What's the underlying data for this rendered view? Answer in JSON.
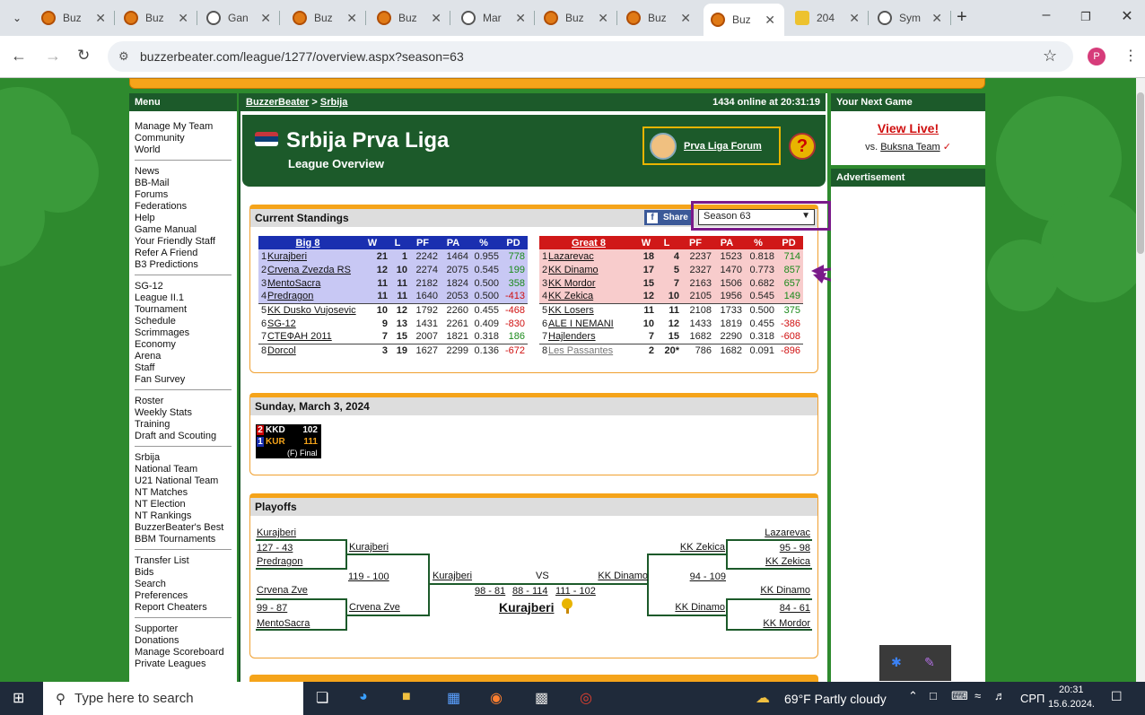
{
  "browser": {
    "tabs": [
      {
        "label": "Buz",
        "icon": "basketball-icon"
      },
      {
        "label": "Buz",
        "icon": "basketball-icon"
      },
      {
        "label": "Gan",
        "icon": "clock-icon"
      },
      {
        "label": "Buz",
        "icon": "basketball-icon"
      },
      {
        "label": "Buz",
        "icon": "basketball-icon"
      },
      {
        "label": "Mar",
        "icon": "chain-icon"
      },
      {
        "label": "Buz",
        "icon": "basketball-icon"
      },
      {
        "label": "Buz",
        "icon": "basketball-icon"
      },
      {
        "label": "Buz",
        "icon": "basketball-icon"
      },
      {
        "label": "204",
        "icon": "2048-icon"
      },
      {
        "label": "Sym",
        "icon": "symbol-icon"
      }
    ],
    "url": "buzzerbeater.com/league/1277/overview.aspx?season=63",
    "profile_initial": "P"
  },
  "left_menu": {
    "title": "Menu",
    "groups": [
      [
        "Manage My Team",
        "Community",
        "World"
      ],
      [
        "News",
        "BB-Mail",
        "Forums",
        "Federations",
        "Help",
        "Game Manual",
        "Your Friendly Staff",
        "Refer A Friend",
        "B3 Predictions"
      ],
      [
        "SG-12",
        "League II.1",
        "Tournament",
        "Schedule",
        "Scrimmages",
        "Economy",
        "Arena",
        "Staff",
        "Fan Survey"
      ],
      [
        "Roster",
        "Weekly Stats",
        "Training",
        "Draft and Scouting"
      ],
      [
        "Srbija",
        "National Team",
        "U21 National Team",
        "NT Matches",
        "NT Election",
        "NT Rankings",
        "BuzzerBeater's Best",
        "BBM Tournaments"
      ],
      [
        "Transfer List",
        "Bids",
        "Search",
        "Preferences",
        "Report Cheaters"
      ],
      [
        "Supporter",
        "Donations",
        "Manage Scoreboard",
        "Private Leagues"
      ]
    ]
  },
  "breadcrumb": {
    "root": "BuzzerBeater",
    "sep": " > ",
    "current": "Srbija",
    "online": "1434 online at 20:31:19"
  },
  "league": {
    "title": "Srbija Prva Liga",
    "subtitle": "League Overview",
    "forum_link": "Prva Liga Forum",
    "help": "?"
  },
  "standings": {
    "title": "Current Standings",
    "share": "Share",
    "season": "Season 63",
    "columns": [
      "W",
      "L",
      "PF",
      "PA",
      "%",
      "PD"
    ],
    "conferences": [
      {
        "name": "Big 8",
        "header_color": "#1a2fb0",
        "highlight_color": "#c8c8f4",
        "rows": [
          {
            "rank": "1",
            "team": "Kurajberi",
            "w": "21",
            "l": "1",
            "pf": "2242",
            "pa": "1464",
            "pct": "0.955",
            "pd": "778"
          },
          {
            "rank": "2",
            "team": "Crvena Zvezda RS",
            "w": "12",
            "l": "10",
            "pf": "2274",
            "pa": "2075",
            "pct": "0.545",
            "pd": "199"
          },
          {
            "rank": "3",
            "team": "MentoSacra",
            "w": "11",
            "l": "11",
            "pf": "2182",
            "pa": "1824",
            "pct": "0.500",
            "pd": "358"
          },
          {
            "rank": "4",
            "team": "Predragon",
            "w": "11",
            "l": "11",
            "pf": "1640",
            "pa": "2053",
            "pct": "0.500",
            "pd": "-413"
          },
          {
            "rank": "5",
            "team": "KK Dusko Vujosevic",
            "w": "10",
            "l": "12",
            "pf": "1792",
            "pa": "2260",
            "pct": "0.455",
            "pd": "-468"
          },
          {
            "rank": "6",
            "team": "SG-12",
            "w": "9",
            "l": "13",
            "pf": "1431",
            "pa": "2261",
            "pct": "0.409",
            "pd": "-830"
          },
          {
            "rank": "7",
            "team": "СТЕФАН 2011",
            "w": "7",
            "l": "15",
            "pf": "2007",
            "pa": "1821",
            "pct": "0.318",
            "pd": "186"
          },
          {
            "rank": "8",
            "team": "Dorcol",
            "w": "3",
            "l": "19",
            "pf": "1627",
            "pa": "2299",
            "pct": "0.136",
            "pd": "-672"
          }
        ]
      },
      {
        "name": "Great 8",
        "header_color": "#d01818",
        "highlight_color": "#f8cccc",
        "rows": [
          {
            "rank": "1",
            "team": "Lazarevac",
            "w": "18",
            "l": "4",
            "pf": "2237",
            "pa": "1523",
            "pct": "0.818",
            "pd": "714"
          },
          {
            "rank": "2",
            "team": "KK Dinamo",
            "w": "17",
            "l": "5",
            "pf": "2327",
            "pa": "1470",
            "pct": "0.773",
            "pd": "857"
          },
          {
            "rank": "3",
            "team": "KK Mordor",
            "w": "15",
            "l": "7",
            "pf": "2163",
            "pa": "1506",
            "pct": "0.682",
            "pd": "657"
          },
          {
            "rank": "4",
            "team": "KK Zekica",
            "w": "12",
            "l": "10",
            "pf": "2105",
            "pa": "1956",
            "pct": "0.545",
            "pd": "149"
          },
          {
            "rank": "5",
            "team": "KK Losers",
            "w": "11",
            "l": "11",
            "pf": "2108",
            "pa": "1733",
            "pct": "0.500",
            "pd": "375"
          },
          {
            "rank": "6",
            "team": "ALE I NEMANI",
            "w": "10",
            "l": "12",
            "pf": "1433",
            "pa": "1819",
            "pct": "0.455",
            "pd": "-386"
          },
          {
            "rank": "7",
            "team": "Hajlenders",
            "w": "7",
            "l": "15",
            "pf": "1682",
            "pa": "2290",
            "pct": "0.318",
            "pd": "-608"
          },
          {
            "rank": "8",
            "team": "Les Passantes",
            "w": "2",
            "l": "20*",
            "pf": "786",
            "pa": "1682",
            "pct": "0.091",
            "pd": "-896"
          }
        ]
      }
    ]
  },
  "day": {
    "title": "Sunday, March 3, 2024",
    "game": {
      "home_seed": "2",
      "home": "KKD",
      "home_score": "102",
      "away_seed": "1",
      "away": "KUR",
      "away_score": "111",
      "status": "(F) Final"
    }
  },
  "playoffs": {
    "title": "Playoffs",
    "left": {
      "qf1_top": "Kurajberi",
      "qf1_score": "127 - 43",
      "qf1_bottom": "Predragon",
      "qf2_top": "Crvena Zve",
      "qf2_score": "99 - 87",
      "qf2_bottom": "MentoSacra",
      "sf_top": "Kurajberi",
      "sf_score": "119 - 100",
      "sf_bottom": "Crvena Zve"
    },
    "right": {
      "qf1_top": "Lazarevac",
      "qf1_score": "95 - 98",
      "qf1_bottom": "KK Zekica",
      "qf2_top": "KK Dinamo",
      "qf2_score": "84 - 61",
      "qf2_bottom": "KK Mordor",
      "sf_top": "KK Zekica",
      "sf_score": "94 - 109",
      "sf_bottom": "KK Dinamo"
    },
    "final": {
      "left": "Kurajberi",
      "vs": "VS",
      "right": "KK Dinamo",
      "g1": "98 - 81",
      "g2": "88 - 114",
      "g3": "111 - 102",
      "champion": "Kurajberi"
    }
  },
  "right": {
    "next_game_title": "Your Next Game",
    "view_live": "View Live!",
    "vs_prefix": "vs.",
    "vs_team": "Buksna Team",
    "check": "✓",
    "advertisement": "Advertisement"
  },
  "taskbar": {
    "search_placeholder": "Type here to search",
    "weather": "69°F  Partly cloudy",
    "lang": "СРП",
    "time": "20:31",
    "date": "15.6.2024."
  }
}
